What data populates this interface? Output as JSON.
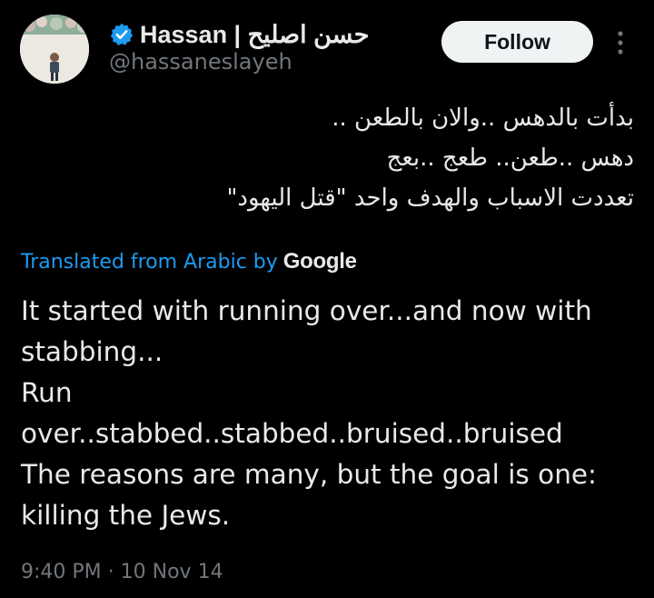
{
  "author": {
    "display_name": "Hassan | حسن اصليح",
    "handle": "@hassaneslayeh",
    "verified": true
  },
  "follow_label": "Follow",
  "tweet": {
    "original_lines": [
      "بدأت بالدهس ..والان بالطعن ..",
      "دهس ..طعن.. طعج ..بعج",
      "تعددت الاسباب والهدف واحد \"قتل اليهود\""
    ],
    "translated_from": "Translated from Arabic by",
    "translator": "Google",
    "translation_lines": [
      "It started with running over...and now with",
      "stabbing...",
      "Run",
      "over..stabbed..stabbed..bruised..bruised",
      "The reasons are many, but the goal is one:",
      "killing the Jews."
    ]
  },
  "meta": {
    "time": "9:40 PM",
    "separator": "·",
    "date": "10 Nov 14"
  },
  "colors": {
    "background": "#000000",
    "text": "#e7e9ea",
    "secondary": "#71767b",
    "link": "#1d9bf0",
    "button_bg": "#eff3f4"
  },
  "icons": {
    "verified": "verified-badge-icon",
    "more": "more-options-icon"
  }
}
